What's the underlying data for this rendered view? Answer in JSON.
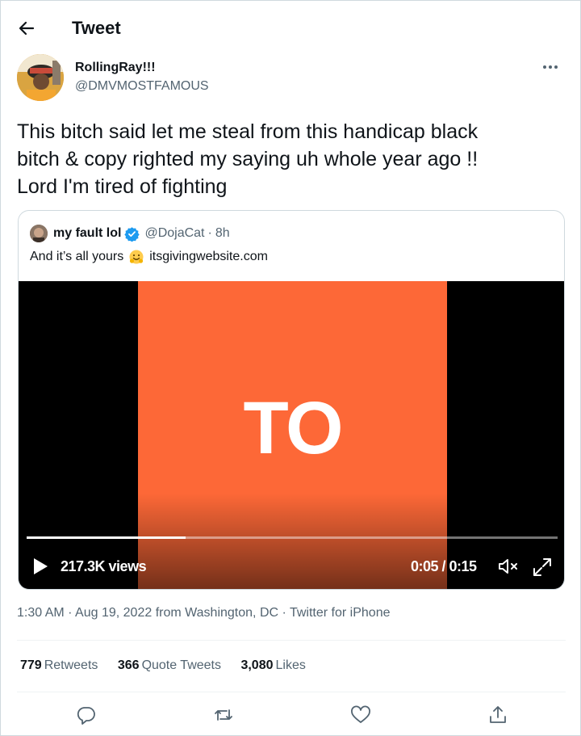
{
  "header": {
    "title": "Tweet",
    "back_icon": "arrow-left-icon"
  },
  "author": {
    "name": "RollingRay!!!",
    "handle": "@DMVMOSTFAMOUS",
    "more_icon": "more-horizontal-icon"
  },
  "tweet": {
    "lines": [
      "This bitch said let me steal from this handicap black",
      "bitch & copy righted my saying uh whole year ago !!",
      "Lord I'm tired of fighting"
    ]
  },
  "quote": {
    "name": "my fault lol",
    "verified_icon": "verified-badge-icon",
    "handle": "@DojaCat",
    "separator": "·",
    "age": "8h",
    "text_before": "And it’s all yours",
    "emoji": "smiling-face-emoji-icon",
    "link": "itsgivingwebsite.com",
    "video": {
      "frame_text": "TO",
      "views": "217.3K views",
      "time": "0:05 / 0:15",
      "progress_fraction": 0.3,
      "colors": {
        "background": "#000000",
        "panel": "#fd6837"
      }
    }
  },
  "meta": {
    "time": "1:30 AM",
    "sep1": "·",
    "date": "Aug 19, 2022",
    "location": "from Washington, DC",
    "sep2": "·",
    "source": "Twitter for iPhone"
  },
  "stats": {
    "retweets_count": "779",
    "retweets_label": "Retweets",
    "quotes_count": "366",
    "quotes_label": "Quote Tweets",
    "likes_count": "3,080",
    "likes_label": "Likes"
  },
  "actions": {
    "reply": "reply-icon",
    "retweet": "retweet-icon",
    "like": "heart-icon",
    "share": "share-icon"
  },
  "colors": {
    "text": "#0f1419",
    "muted": "#536471",
    "accent": "#1d9bf0",
    "border": "#cfd9de"
  }
}
